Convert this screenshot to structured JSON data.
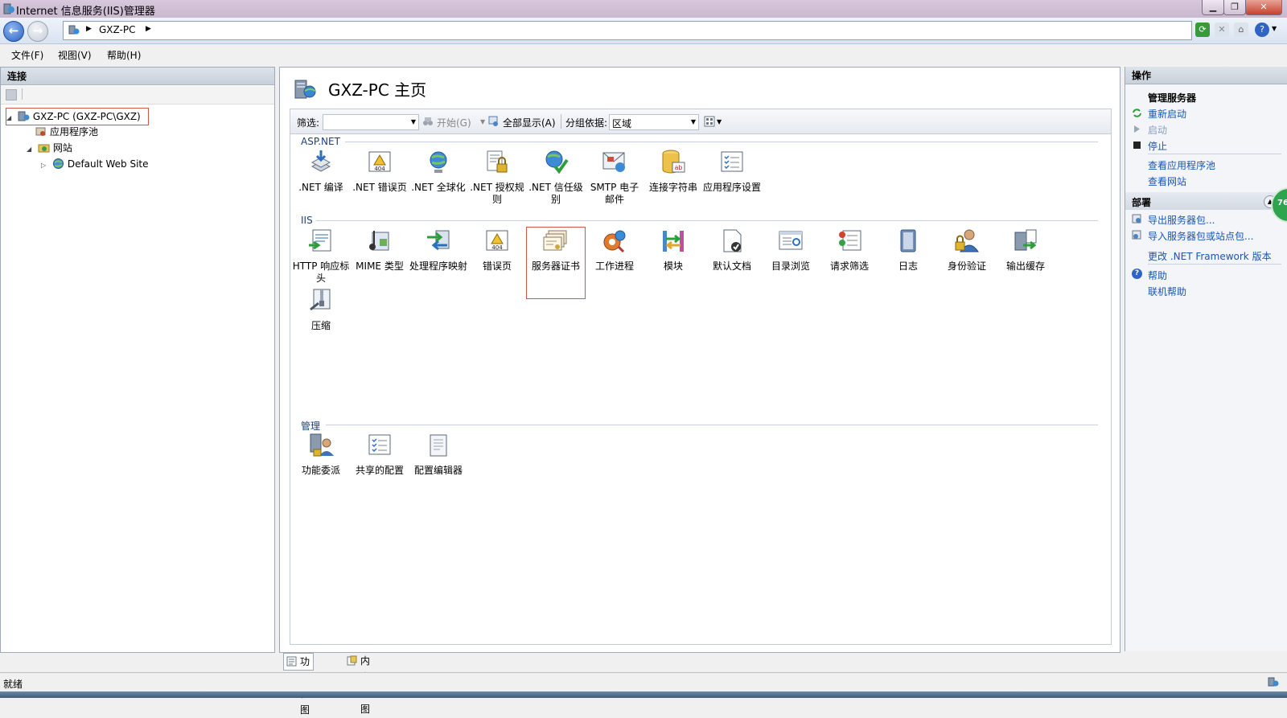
{
  "window": {
    "title": "Internet 信息服务(IIS)管理器"
  },
  "address": {
    "crumb": "GXZ-PC"
  },
  "menu": {
    "file": "文件(F)",
    "view": "视图(V)",
    "help": "帮助(H)"
  },
  "connections": {
    "title": "连接",
    "tree": {
      "server": "GXZ-PC (GXZ-PC\\GXZ)",
      "app_pools": "应用程序池",
      "sites": "网站",
      "default_site": "Default Web Site"
    }
  },
  "home": {
    "title": "GXZ-PC 主页",
    "filter": {
      "label": "筛选:",
      "go": "开始(G)",
      "show_all": "全部显示(A)",
      "group_by_label": "分组依据:",
      "group_by_value": "区域"
    },
    "sections": {
      "aspnet": "ASP.NET",
      "iis": "IIS",
      "management": "管理"
    },
    "aspnet_features": [
      ".NET 编译",
      ".NET 错误页",
      ".NET 全球化",
      ".NET 授权规则",
      ".NET 信任级别",
      "SMTP 电子邮件",
      "连接字符串",
      "应用程序设置"
    ],
    "iis_features": [
      "HTTP 响应标头",
      "MIME 类型",
      "处理程序映射",
      "错误页",
      "服务器证书",
      "工作进程",
      "模块",
      "默认文档",
      "目录浏览",
      "请求筛选",
      "日志",
      "身份验证",
      "输出缓存",
      "压缩"
    ],
    "management_features": [
      "功能委派",
      "共享的配置",
      "配置编辑器"
    ]
  },
  "actions": {
    "title": "操作",
    "manage_server": "管理服务器",
    "restart": "重新启动",
    "start": "启动",
    "stop": "停止",
    "view_app_pools": "查看应用程序池",
    "view_sites": "查看网站",
    "deploy": "部署",
    "export_package": "导出服务器包...",
    "import_package": "导入服务器包或站点包...",
    "change_framework": "更改 .NET Framework 版本",
    "help": "帮助",
    "online_help": "联机帮助"
  },
  "badge": "76",
  "view_tabs": {
    "features": "功能视图",
    "content": "内容视图"
  },
  "status": "就绪"
}
